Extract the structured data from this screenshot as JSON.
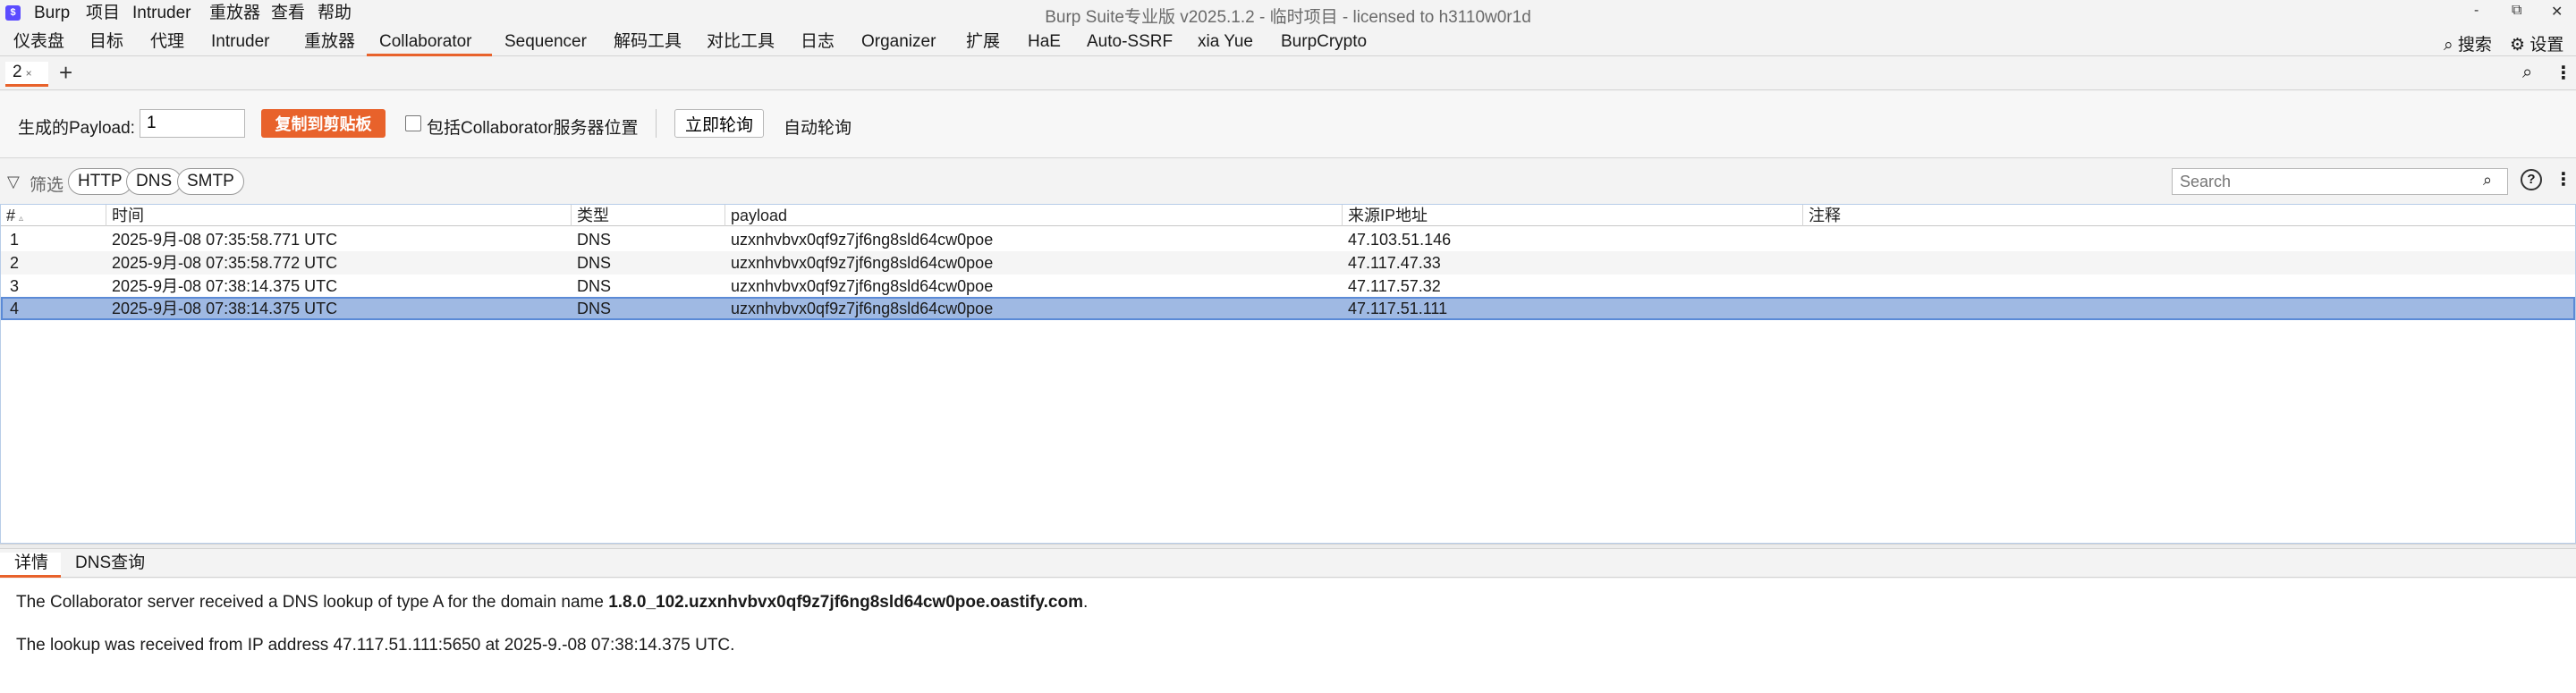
{
  "titlebar": {
    "logo_glyph": "$",
    "menu": [
      "Burp",
      "项目",
      "Intruder",
      "重放器",
      "查看",
      "帮助"
    ],
    "window_title": "Burp Suite专业版  v2025.1.2 - 临时项目 - licensed to h3110w0r1d",
    "controls": {
      "minimize": "-",
      "restore": "⧉",
      "close": "✕"
    }
  },
  "main_tabs": {
    "items": [
      "仪表盘",
      "目标",
      "代理",
      "Intruder",
      "重放器",
      "Collaborator",
      "Sequencer",
      "解码工具",
      "对比工具",
      "日志",
      "Organizer",
      "扩展",
      "HaE",
      "Auto-SSRF",
      "xia Yue",
      "BurpCrypto"
    ],
    "active": "Collaborator",
    "search_label": "搜索",
    "settings_label": "设置"
  },
  "sub_tabs": {
    "tab_label": "2",
    "close_glyph": "×",
    "add_glyph": "+"
  },
  "payload_panel": {
    "label": "生成的Payload:",
    "input_value": "1",
    "copy_button": "复制到剪贴板",
    "include_label": "包括Collaborator服务器位置",
    "poll_now": "立即轮询",
    "auto_poll": "自动轮询"
  },
  "filter_row": {
    "filter_label": "筛选",
    "chips": [
      "HTTP",
      "DNS",
      "SMTP"
    ],
    "search_placeholder": "Search",
    "help_glyph": "?"
  },
  "table": {
    "headers": {
      "num": "#",
      "time": "时间",
      "type": "类型",
      "payload": "payload",
      "source_ip": "来源IP地址",
      "comment": "注释"
    },
    "rows": [
      {
        "num": "1",
        "time": "2025-9月-08 07:35:58.771 UTC",
        "type": "DNS",
        "payload": "uzxnhvbvx0qf9z7jf6ng8sld64cw0poe",
        "source_ip": "47.103.51.146",
        "comment": ""
      },
      {
        "num": "2",
        "time": "2025-9月-08 07:35:58.772 UTC",
        "type": "DNS",
        "payload": "uzxnhvbvx0qf9z7jf6ng8sld64cw0poe",
        "source_ip": "47.117.47.33",
        "comment": ""
      },
      {
        "num": "3",
        "time": "2025-9月-08 07:38:14.375 UTC",
        "type": "DNS",
        "payload": "uzxnhvbvx0qf9z7jf6ng8sld64cw0poe",
        "source_ip": "47.117.57.32",
        "comment": ""
      },
      {
        "num": "4",
        "time": "2025-9月-08 07:38:14.375 UTC",
        "type": "DNS",
        "payload": "uzxnhvbvx0qf9z7jf6ng8sld64cw0poe",
        "source_ip": "47.117.51.111",
        "comment": ""
      }
    ],
    "selected_row": "4"
  },
  "detail": {
    "tabs": [
      "详情",
      "DNS查询"
    ],
    "active_tab": "详情",
    "line1_prefix": "The Collaborator server received a DNS lookup of type A for the domain name ",
    "line1_domain": "1.8.0_102.uzxnhvbvx0qf9z7jf6ng8sld64cw0poe.oastify.com",
    "line1_suffix": ".",
    "line2": "The lookup was received from IP address 47.117.51.111:5650 at 2025-9.-08 07:38:14.375 UTC."
  },
  "colors": {
    "accent": "#e8622b",
    "selection": "#9fb9e3",
    "logo": "#5b4cff"
  }
}
